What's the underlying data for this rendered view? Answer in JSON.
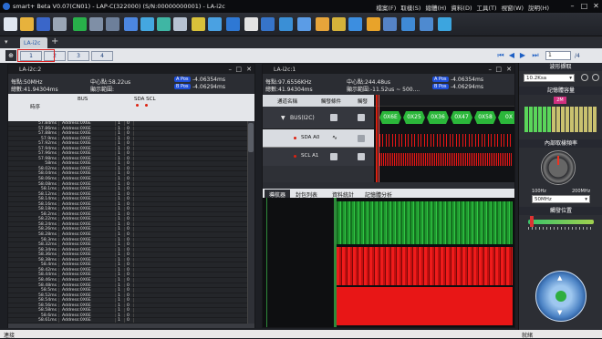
{
  "window": {
    "title": "smart+ Beta V0.07(CN01) - LAP-C(322000) (S/N:00000000001) - LA-i2c"
  },
  "menu": [
    "檔案(F)",
    "取樣(S)",
    "總體(H)",
    "資料(D)",
    "工具(T)",
    "視窗(W)",
    "說明(H)"
  ],
  "doc_tab": "LA-i2c",
  "pages": [
    "1",
    "2",
    "3",
    "4"
  ],
  "page_input": "1",
  "page_total": "/4",
  "left_panel": {
    "title": "LA-i2c:2",
    "rate": "每點:50MHz",
    "total": "總數:41.94304ms",
    "center": "中心點:58.22us",
    "range": "顯示範圍:",
    "a_pos_label": "A Pos",
    "a_pos_val": "-4.06354ms",
    "b_pos_label": "B Pos",
    "b_pos_val": "-4.06294ms",
    "col_time": "時序",
    "col_bus": "BUS",
    "col_sda_scl": "SDA SCL",
    "row_addr": "Address:0X6E",
    "times": [
      "57.84ms",
      "57.86ms",
      "57.88ms",
      "57.9ms",
      "57.92ms",
      "57.94ms",
      "57.96ms",
      "57.98ms",
      "58ms",
      "58.02ms",
      "58.04ms",
      "58.06ms",
      "58.08ms",
      "58.1ms",
      "58.12ms",
      "58.14ms",
      "58.16ms",
      "58.18ms",
      "58.2ms",
      "58.22ms",
      "58.24ms",
      "58.26ms",
      "58.28ms",
      "58.3ms",
      "58.32ms",
      "58.34ms",
      "58.36ms",
      "58.38ms",
      "58.4ms",
      "58.42ms",
      "58.44ms",
      "58.46ms",
      "58.48ms",
      "58.5ms",
      "58.52ms",
      "58.54ms",
      "58.56ms",
      "58.58ms",
      "58.6ms",
      "58.61ms"
    ]
  },
  "wave_panel": {
    "title": "LA-i2c:1",
    "rate": "每點:97.6556KHz",
    "total": "總數:41.94304ms",
    "center": "中心點:244.48us",
    "range": "顯示範圍:-11.52us ~ 500....",
    "a_pos_label": "A Pos",
    "a_pos_val": "-4.06354ms",
    "b_pos_label": "B Pos",
    "b_pos_val": "-4.06294ms",
    "col_name": "通道名稱",
    "col_trig": "觸發條件",
    "col_disp": "觸發",
    "ch_bus": "BUS(I2C)",
    "ch_sda": "SDA A0",
    "ch_scl": "SCL A1",
    "decoded": [
      "0X6E",
      "0X25",
      "0X36",
      "0X47",
      "0X58",
      "0X"
    ]
  },
  "bottom_tabs": [
    "導航器",
    "封包列表",
    "資料統計",
    "記憶體分析"
  ],
  "sidebar": {
    "sample_rate_label": "波形擷取",
    "sample_rate_value": "10.2Ksa",
    "memory_label": "記憶體容量",
    "memory_badge": "2M",
    "freq_label": "內部取樣頻率",
    "freq_min": "100Hz",
    "freq_max": "200MHz",
    "freq_value": "50MHz",
    "trigger_label": "觸發位置"
  },
  "status_text": "連接",
  "status_right": "就緒",
  "colors": {
    "accent": "#2a6bd1",
    "wave_green": "#27b83a",
    "wave_red": "#e81616",
    "a_badge": "#1f4fd8",
    "b_badge": "#1f4fd8"
  }
}
